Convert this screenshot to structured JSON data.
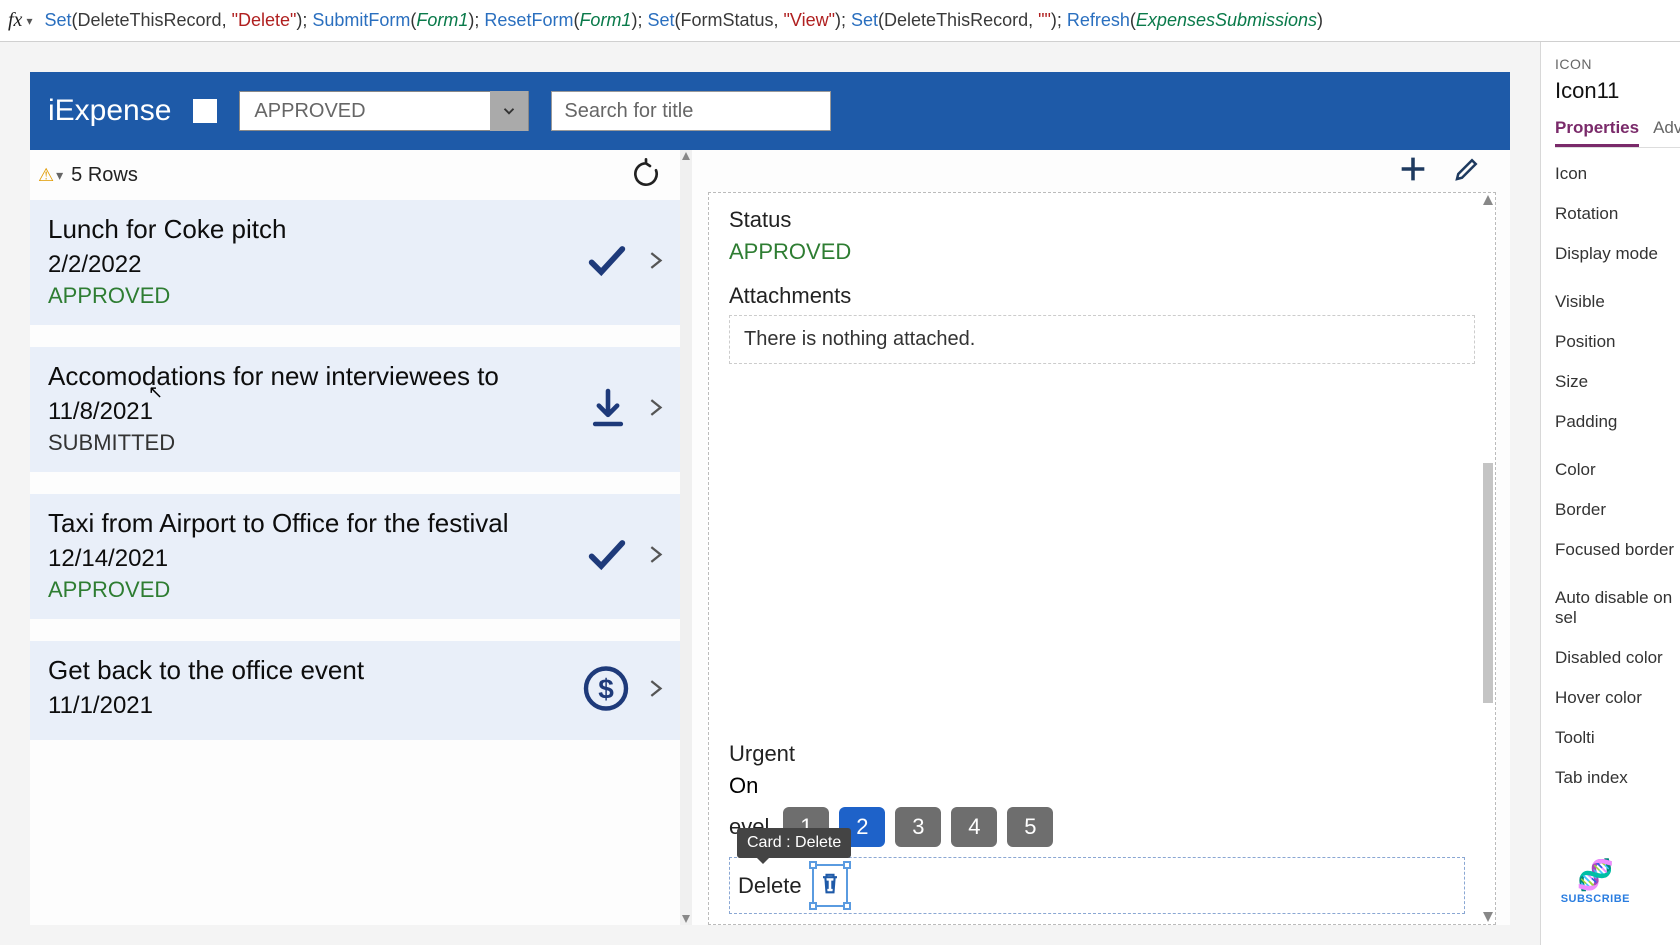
{
  "formula": {
    "tokens": [
      {
        "t": "Set",
        "c": "fn-set"
      },
      {
        "t": "(",
        "c": "fn-paren"
      },
      {
        "t": "DeleteThisRecord",
        "c": "fn-var"
      },
      {
        "t": ", ",
        "c": "fn-sep"
      },
      {
        "t": "\"Delete\"",
        "c": "fn-str"
      },
      {
        "t": "); ",
        "c": "fn-paren"
      },
      {
        "t": "SubmitForm",
        "c": "fn-call"
      },
      {
        "t": "(",
        "c": "fn-paren"
      },
      {
        "t": "Form1",
        "c": "fn-form"
      },
      {
        "t": "); ",
        "c": "fn-paren"
      },
      {
        "t": "ResetForm",
        "c": "fn-call"
      },
      {
        "t": "(",
        "c": "fn-paren"
      },
      {
        "t": "Form1",
        "c": "fn-form"
      },
      {
        "t": "); ",
        "c": "fn-paren"
      },
      {
        "t": "Set",
        "c": "fn-set"
      },
      {
        "t": "(",
        "c": "fn-paren"
      },
      {
        "t": "FormStatus",
        "c": "fn-var"
      },
      {
        "t": ", ",
        "c": "fn-sep"
      },
      {
        "t": "\"View\"",
        "c": "fn-str"
      },
      {
        "t": "); ",
        "c": "fn-paren"
      },
      {
        "t": "Set",
        "c": "fn-set"
      },
      {
        "t": "(",
        "c": "fn-paren"
      },
      {
        "t": "DeleteThisRecord",
        "c": "fn-var"
      },
      {
        "t": ", ",
        "c": "fn-sep"
      },
      {
        "t": "\"\"",
        "c": "fn-str"
      },
      {
        "t": "); ",
        "c": "fn-paren"
      },
      {
        "t": "Refresh",
        "c": "fn-call"
      },
      {
        "t": "(",
        "c": "fn-paren"
      },
      {
        "t": "ExpensesSubmissions",
        "c": "fn-form"
      },
      {
        "t": ")",
        "c": "fn-paren"
      }
    ]
  },
  "header": {
    "title": "iExpense",
    "dropdown_value": "APPROVED",
    "search_placeholder": "Search for title"
  },
  "list": {
    "rows_label": "5 Rows",
    "items": [
      {
        "title": "Lunch for Coke pitch",
        "date": "2/2/2022",
        "status": "APPROVED",
        "status_class": "st-approved",
        "icon": "check"
      },
      {
        "title": "Accomodations for new interviewees to",
        "date": "11/8/2021",
        "status": "SUBMITTED",
        "status_class": "st-submitted",
        "icon": "download"
      },
      {
        "title": "Taxi from Airport to Office for the festival",
        "date": "12/14/2021",
        "status": "APPROVED",
        "status_class": "st-approved",
        "icon": "check"
      },
      {
        "title": "Get back to the office event",
        "date": "11/1/2021",
        "status": "",
        "status_class": "",
        "icon": "dollar"
      }
    ]
  },
  "detail": {
    "status_label": "Status",
    "status_value": "APPROVED",
    "attachments_label": "Attachments",
    "attachments_empty": "There is nothing attached.",
    "urgent_label": "Urgent",
    "urgent_value": "On",
    "approval_label": "evel",
    "levels": [
      "1",
      "2",
      "3",
      "4",
      "5"
    ],
    "active_level": "2",
    "delete_label": "Delete",
    "tooltip": "Card : Delete"
  },
  "props": {
    "section": "ICON",
    "name": "Icon11",
    "tabs": [
      "Properties",
      "Adva"
    ],
    "rows": [
      "Icon",
      "Rotation",
      "Display mode",
      "Visible",
      "Position",
      "Size",
      "Padding",
      "Color",
      "Border",
      "Focused border",
      "Auto disable on sel",
      "Disabled color",
      "Hover color",
      "Toolti",
      "Tab index"
    ]
  },
  "subscribe": "SUBSCRIBE"
}
